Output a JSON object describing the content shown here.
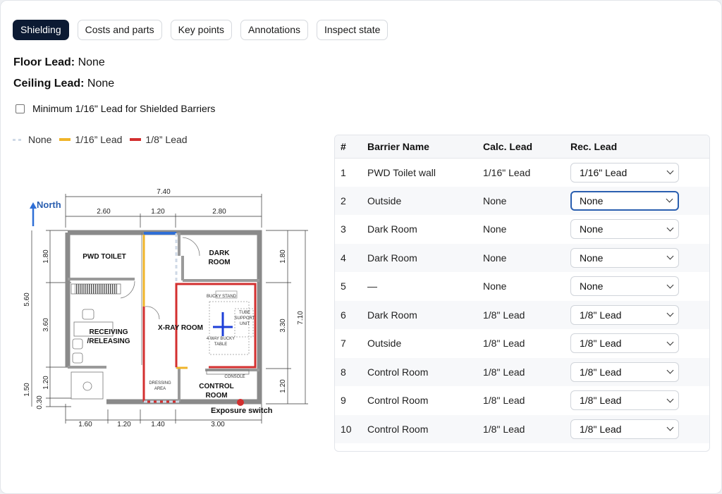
{
  "tabs": [
    {
      "label": "Shielding",
      "active": true
    },
    {
      "label": "Costs and parts",
      "active": false
    },
    {
      "label": "Key points",
      "active": false
    },
    {
      "label": "Annotations",
      "active": false
    },
    {
      "label": "Inspect state",
      "active": false
    }
  ],
  "floor_lead": {
    "label": "Floor Lead:",
    "value": "None"
  },
  "ceiling_lead": {
    "label": "Ceiling Lead:",
    "value": "None"
  },
  "min_lead_checkbox": {
    "label": "Minimum 1/16\" Lead for Shielded Barriers",
    "checked": false
  },
  "legend": [
    {
      "label": "None",
      "color": "#cfd9e6"
    },
    {
      "label": "1/16” Lead",
      "color": "#f0b429"
    },
    {
      "label": "1/8” Lead",
      "color": "#d32f2f"
    }
  ],
  "plan": {
    "north": "North",
    "overall_width": "7.40",
    "top_dims": [
      "2.60",
      "1.20",
      "2.80"
    ],
    "bottom_dims": [
      "1.60",
      "1.20",
      "1.40",
      "3.00"
    ],
    "left_dims": [
      "1.80",
      "3.60",
      "1.20",
      "0.30"
    ],
    "left_total": "5.60",
    "left_extra": "1.50",
    "right_dims": [
      "1.80",
      "3.30",
      "1.20"
    ],
    "right_total": "7.10",
    "rooms": {
      "pwd_toilet": "PWD TOILET",
      "dark_room_1": "DARK",
      "dark_room_2": "ROOM",
      "xray": "X-RAY ROOM",
      "receiving_1": "RECEIVING",
      "receiving_2": "/RELEASING",
      "control_1": "CONTROL",
      "control_2": "ROOM",
      "dressing_1": "DRESSING",
      "dressing_2": "AREA",
      "bucky_stand": "BUCKY STAND",
      "tube_1": "TUBE",
      "tube_2": "SUPPORT",
      "tube_3": "UNIT",
      "table_1": "4 WAY BUCKY",
      "table_2": "TABLE",
      "console": "CONSOLE"
    },
    "exposure_switch": "Exposure switch"
  },
  "table": {
    "headers": [
      "#",
      "Barrier Name",
      "Calc. Lead",
      "Rec. Lead"
    ],
    "rows": [
      {
        "num": "1",
        "name": "PWD Toilet wall",
        "calc": "1/16\" Lead",
        "rec": "1/16\" Lead"
      },
      {
        "num": "2",
        "name": "Outside",
        "calc": "None",
        "rec": "None"
      },
      {
        "num": "3",
        "name": "Dark Room",
        "calc": "None",
        "rec": "None"
      },
      {
        "num": "4",
        "name": "Dark Room",
        "calc": "None",
        "rec": "None"
      },
      {
        "num": "5",
        "name": "—",
        "calc": "None",
        "rec": "None"
      },
      {
        "num": "6",
        "name": "Dark Room",
        "calc": "1/8\" Lead",
        "rec": "1/8\" Lead"
      },
      {
        "num": "7",
        "name": "Outside",
        "calc": "1/8\" Lead",
        "rec": "1/8\" Lead"
      },
      {
        "num": "8",
        "name": "Control Room",
        "calc": "1/8\" Lead",
        "rec": "1/8\" Lead"
      },
      {
        "num": "9",
        "name": "Control Room",
        "calc": "1/8\" Lead",
        "rec": "1/8\" Lead"
      },
      {
        "num": "10",
        "name": "Control Room",
        "calc": "1/8\" Lead",
        "rec": "1/8\" Lead"
      }
    ]
  }
}
